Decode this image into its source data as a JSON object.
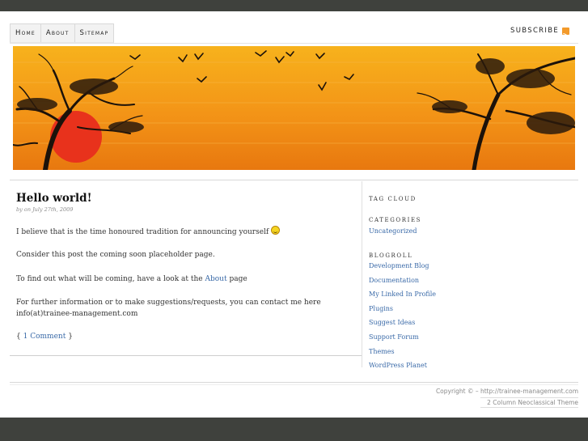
{
  "nav": {
    "items": [
      "Home",
      "About",
      "Sitemap"
    ],
    "subscribe_label": "SUBSCRIBE"
  },
  "icons": {
    "rss": "rss-icon",
    "smiley": "smiley-icon"
  },
  "colors": {
    "bar": "#3f413d",
    "link": "#3a6aa8",
    "banner_sky": "#f39a1a",
    "sun": "#e8321c"
  },
  "post": {
    "title": "Hello world!",
    "meta": "by on July 27th, 2009",
    "p1": "I believe that is the time honoured tradition for announcing yourself",
    "p2": "Consider this post the coming soon placeholder page.",
    "p3_before": "To find out what will be coming, have a look at the",
    "p3_link": "About",
    "p3_after": "page",
    "p4": "For further information or to make suggestions/requests, you can contact me here info(at)trainee-management.com",
    "comments_open": "{",
    "comments_link": "1 Comment",
    "comments_close": "}"
  },
  "sidebar": {
    "tag_cloud": "TAG CLOUD",
    "categories": "CATEGORIES",
    "categories_items": [
      "Uncategorized"
    ],
    "blogroll": "BLOGROLL",
    "blogroll_items": [
      "Development Blog",
      "Documentation",
      "My Linked In Profile",
      "Plugins",
      "Suggest Ideas",
      "Support Forum",
      "Themes",
      "WordPress Planet"
    ]
  },
  "footer": {
    "copyright": "Copyright © – http://trainee-management.com",
    "theme": "2 Column Neoclassical Theme"
  }
}
